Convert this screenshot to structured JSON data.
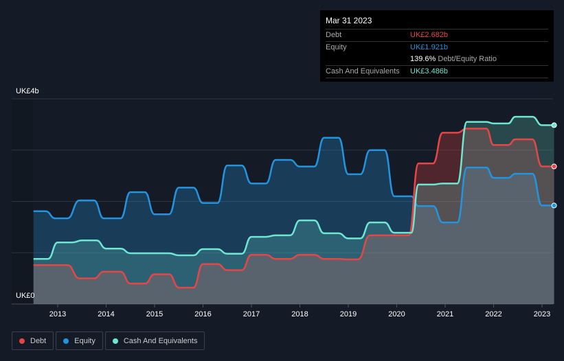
{
  "tooltip": {
    "date": "Mar 31 2023",
    "debt_label": "Debt",
    "debt_value": "UK£2.682b",
    "equity_label": "Equity",
    "equity_value": "UK£1.921b",
    "ratio_value": "139.6%",
    "ratio_label": "Debt/Equity Ratio",
    "cash_label": "Cash And Equivalents",
    "cash_value": "UK£3.486b"
  },
  "legend": [
    {
      "label": "Debt"
    },
    {
      "label": "Equity"
    },
    {
      "label": "Cash And Equivalents"
    }
  ],
  "chart_data": {
    "type": "area",
    "x_ticks": [
      "2013",
      "2014",
      "2015",
      "2016",
      "2017",
      "2018",
      "2019",
      "2020",
      "2021",
      "2022",
      "2023"
    ],
    "y_labels": {
      "top": "UK£4b",
      "bottom": "UK£0"
    },
    "ylim": [
      0,
      4
    ],
    "xlim": [
      2012,
      2023.25
    ],
    "colors": {
      "Debt": "#e64646",
      "Equity": "#2394df",
      "Cash And Equivalents": "#6ee7d2"
    },
    "series": [
      {
        "name": "Debt",
        "plateaus": [
          [
            2012.5,
            2013.2,
            0.76
          ],
          [
            2013.45,
            2013.75,
            0.5
          ],
          [
            2013.95,
            2014.3,
            0.63
          ],
          [
            2014.5,
            2014.8,
            0.4
          ],
          [
            2015,
            2015.3,
            0.58
          ],
          [
            2015.5,
            2015.8,
            0.32
          ],
          [
            2016,
            2016.3,
            0.78
          ],
          [
            2016.5,
            2016.8,
            0.66
          ],
          [
            2017,
            2017.3,
            0.96
          ],
          [
            2017.5,
            2017.8,
            0.88
          ],
          [
            2018,
            2018.3,
            0.96
          ],
          [
            2018.5,
            2018.8,
            0.88
          ],
          [
            2019,
            2019.2,
            0.87
          ],
          [
            2019.45,
            2020.25,
            1.34
          ],
          [
            2020.45,
            2020.75,
            2.74
          ],
          [
            2020.95,
            2021.25,
            3.34
          ],
          [
            2021.45,
            2021.85,
            3.42
          ],
          [
            2022.0,
            2022.3,
            3.1
          ],
          [
            2022.45,
            2022.8,
            3.21
          ],
          [
            2023.0,
            2023.25,
            2.682
          ]
        ]
      },
      {
        "name": "Equity",
        "plateaus": [
          [
            2012.5,
            2012.75,
            1.81
          ],
          [
            2012.95,
            2013.2,
            1.67
          ],
          [
            2013.45,
            2013.75,
            2.02
          ],
          [
            2013.95,
            2014.3,
            1.67
          ],
          [
            2014.5,
            2014.8,
            2.18
          ],
          [
            2015,
            2015.3,
            1.75
          ],
          [
            2015.5,
            2015.8,
            2.27
          ],
          [
            2016,
            2016.3,
            1.97
          ],
          [
            2016.5,
            2016.8,
            2.7
          ],
          [
            2017,
            2017.3,
            2.35
          ],
          [
            2017.5,
            2017.8,
            2.81
          ],
          [
            2018,
            2018.3,
            2.68
          ],
          [
            2018.5,
            2018.8,
            3.24
          ],
          [
            2019,
            2019.25,
            2.53
          ],
          [
            2019.45,
            2019.75,
            3.0
          ],
          [
            2019.95,
            2020.3,
            2.1
          ],
          [
            2020.45,
            2020.75,
            1.91
          ],
          [
            2020.95,
            2021.25,
            1.59
          ],
          [
            2021.45,
            2021.85,
            2.66
          ],
          [
            2022.0,
            2022.3,
            2.46
          ],
          [
            2022.45,
            2022.8,
            2.54
          ],
          [
            2023.0,
            2023.25,
            1.921
          ]
        ]
      },
      {
        "name": "Cash And Equivalents",
        "plateaus": [
          [
            2012.5,
            2012.8,
            0.88
          ],
          [
            2013,
            2013.3,
            1.2
          ],
          [
            2013.5,
            2013.8,
            1.24
          ],
          [
            2014,
            2014.3,
            1.08
          ],
          [
            2014.5,
            2015.3,
            0.99
          ],
          [
            2015.5,
            2015.8,
            0.95
          ],
          [
            2016,
            2016.3,
            1.07
          ],
          [
            2016.5,
            2016.8,
            0.98
          ],
          [
            2017,
            2017.3,
            1.31
          ],
          [
            2017.5,
            2017.8,
            1.34
          ],
          [
            2018,
            2018.3,
            1.63
          ],
          [
            2018.5,
            2018.8,
            1.38
          ],
          [
            2019,
            2019.25,
            1.28
          ],
          [
            2019.45,
            2019.75,
            1.59
          ],
          [
            2019.95,
            2020.3,
            1.39
          ],
          [
            2020.45,
            2020.75,
            2.33
          ],
          [
            2020.95,
            2021.25,
            2.35
          ],
          [
            2021.45,
            2021.85,
            3.55
          ],
          [
            2022.0,
            2022.3,
            3.52
          ],
          [
            2022.45,
            2022.8,
            3.65
          ],
          [
            2023.0,
            2023.25,
            3.486
          ]
        ]
      }
    ]
  }
}
